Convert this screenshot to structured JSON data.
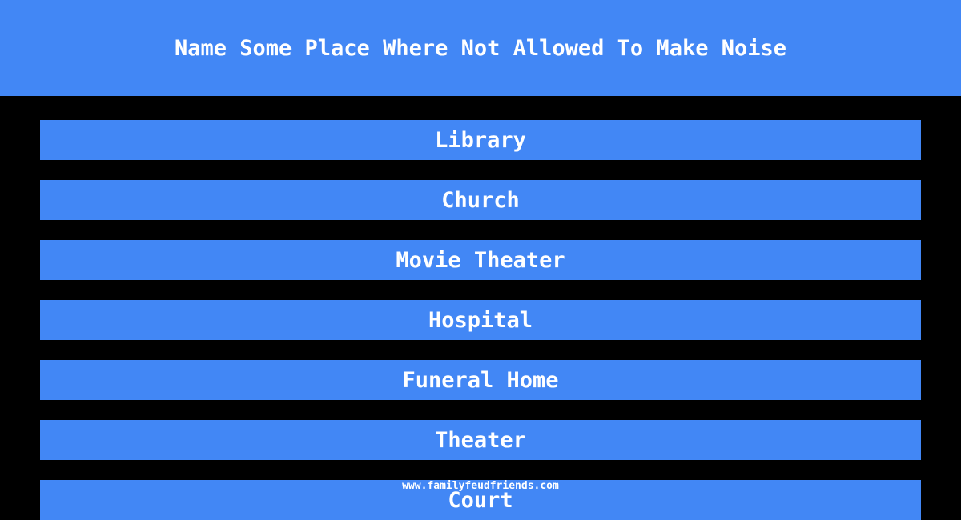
{
  "question": "Name Some Place Where Not Allowed To Make Noise",
  "answers": [
    "Library",
    "Church",
    "Movie Theater",
    "Hospital",
    "Funeral Home",
    "Theater",
    "Court"
  ],
  "watermark": "www.familyfeudfriends.com",
  "colors": {
    "accent": "#4287f5",
    "background": "#000000",
    "text": "#ffffff"
  }
}
